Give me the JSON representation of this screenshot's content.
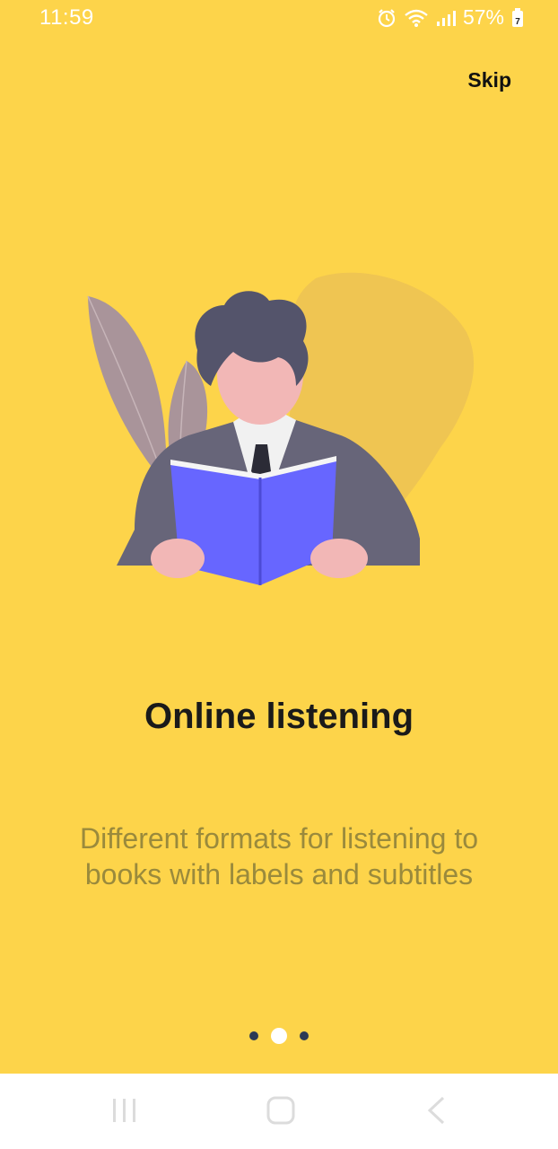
{
  "status_bar": {
    "time": "11:59",
    "battery_percent": "57%",
    "battery_badge": "7",
    "icons": [
      "alarm-icon",
      "wifi-icon",
      "signal-icon",
      "battery-icon"
    ]
  },
  "header": {
    "skip_label": "Skip"
  },
  "onboarding": {
    "title": "Online listening",
    "description": "Different formats for listening to books with labels and subtitles",
    "illustration": "man-reading-book-illustration"
  },
  "pager": {
    "total_pages": 3,
    "active_index": 1
  },
  "nav_bar": {
    "icons": [
      "recent-apps-icon",
      "home-icon",
      "back-icon"
    ]
  },
  "colors": {
    "background": "#FDD44A",
    "title": "#1a1a1a",
    "description": "#9a8a3c",
    "dot_inactive": "#2c3a55",
    "dot_active": "#ffffff"
  }
}
